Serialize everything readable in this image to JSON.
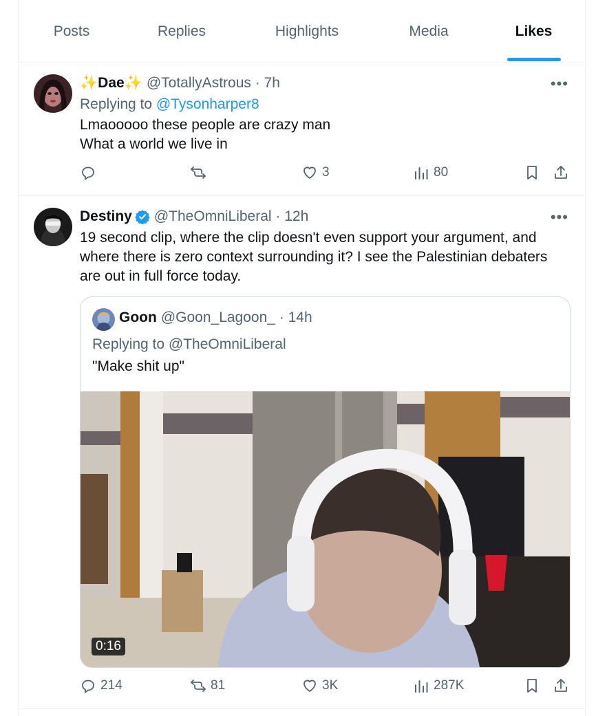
{
  "tabs": [
    {
      "label": "Posts",
      "active": false
    },
    {
      "label": "Replies",
      "active": false
    },
    {
      "label": "Highlights",
      "active": false
    },
    {
      "label": "Media",
      "active": false
    },
    {
      "label": "Likes",
      "active": true
    }
  ],
  "tweets": [
    {
      "name_prefix_emoji": "✨",
      "name": "Dae",
      "name_suffix_emoji": "✨",
      "handle": "@TotallyAstrous · 7h",
      "replying_prefix": "Replying to ",
      "replying_to": "@Tysonharper8",
      "text_line1": "Lmaooooo these people are crazy man",
      "text_line2": "What a world we live in",
      "stats": {
        "replies": "",
        "reposts": "",
        "likes": "3",
        "views": "80"
      }
    },
    {
      "name": "Destiny",
      "verified": true,
      "handle": "@TheOmniLiberal · 12h",
      "text_line1": "19 second clip, where the clip doesn't even support your argument, and",
      "text_line2": "where there is zero context surrounding it? I see the Palestinian debaters",
      "text_line3": "are out in full force today.",
      "quote": {
        "name": "Goon",
        "handle": "@Goon_Lagoon_ · 14h",
        "replying": "Replying to @TheOmniLiberal",
        "text": "\"Make shit up\"",
        "video_duration": "0:16"
      },
      "stats": {
        "replies": "214",
        "reposts": "81",
        "likes": "3K",
        "views": "287K"
      }
    }
  ],
  "colors": {
    "accent": "#1d9bf0",
    "secondary_text": "#536471",
    "verified": "#1d9bf0"
  }
}
